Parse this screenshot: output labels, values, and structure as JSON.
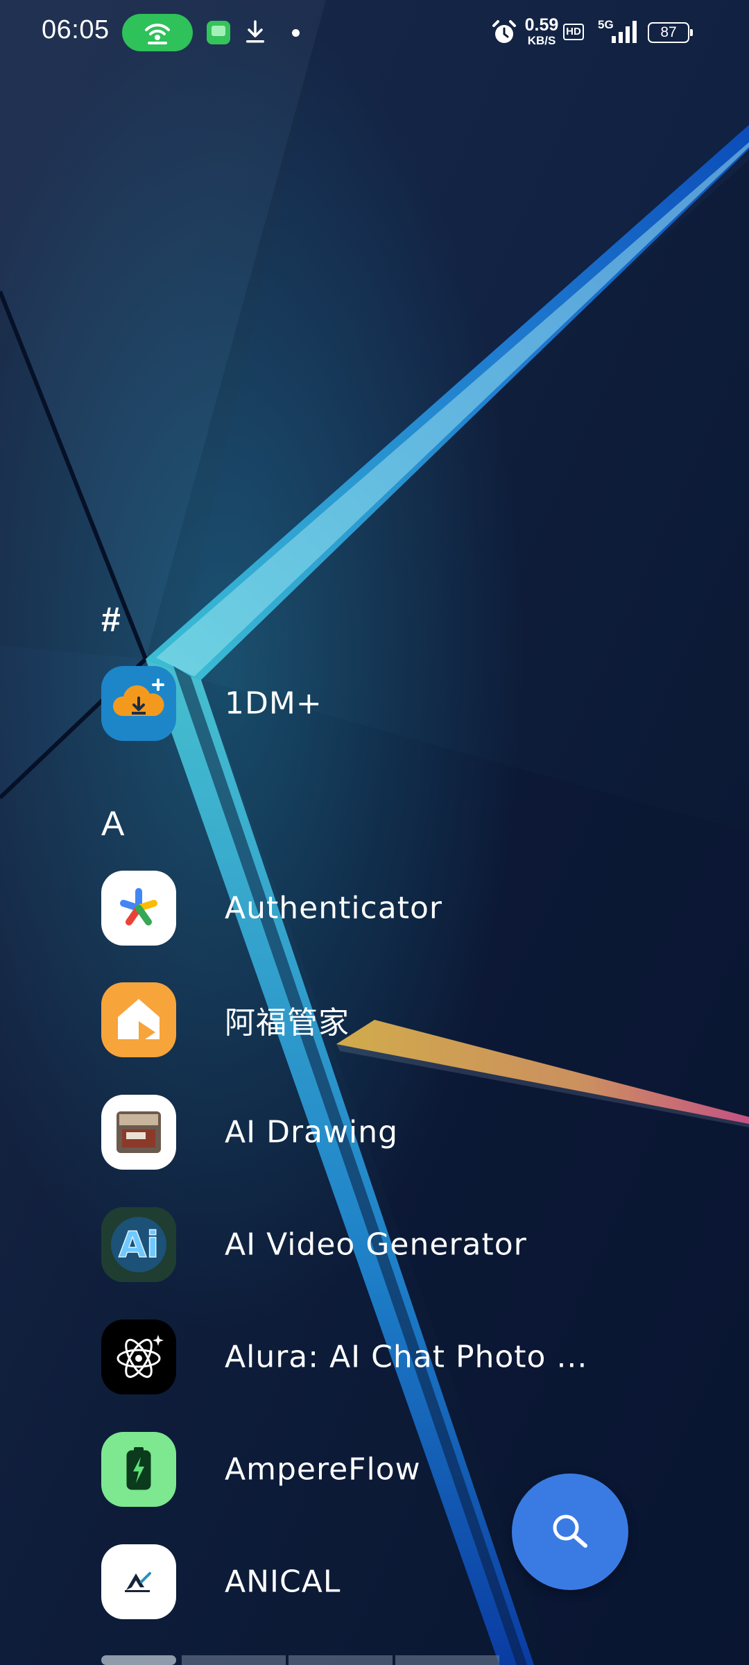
{
  "status_bar": {
    "time": "06:05",
    "speed_value": "0.59",
    "speed_unit": "KB/S",
    "hd_label": "HD",
    "network_label": "5G",
    "battery_level": "87",
    "icons": [
      "hotspot-icon",
      "messages-icon",
      "download-icon",
      "notification-dot",
      "alarm-icon",
      "signal-icon",
      "battery-icon"
    ]
  },
  "sections": [
    {
      "letter": "#",
      "apps": [
        {
          "name": "1DM+",
          "icon": "cloud-download-icon",
          "color": "#1c86c9"
        }
      ]
    },
    {
      "letter": "A",
      "apps": [
        {
          "name": "Authenticator",
          "icon": "authenticator-icon",
          "color": "#ffffff"
        },
        {
          "name": "阿福管家",
          "icon": "afu-house-icon",
          "color": "#f7a43a"
        },
        {
          "name": "AI Drawing",
          "icon": "ai-drawing-icon",
          "color": "#ffffff"
        },
        {
          "name": "AI Video Generator",
          "icon": "ai-video-icon",
          "color": "#1b5fa8"
        },
        {
          "name": "Alura: AI Chat Photo ...",
          "icon": "atom-icon",
          "color": "#000000"
        },
        {
          "name": "AmpereFlow",
          "icon": "battery-charge-icon",
          "color": "#7de88f"
        },
        {
          "name": "ANICAL",
          "icon": "anical-icon",
          "color": "#ffffff"
        }
      ]
    }
  ],
  "fab": {
    "icon": "search-icon",
    "color": "#3a7be3"
  }
}
